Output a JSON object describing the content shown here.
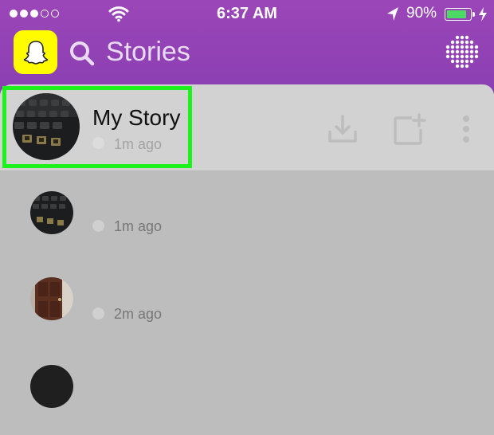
{
  "status_bar": {
    "time": "6:37 AM",
    "battery_percent": "90%",
    "battery_level": 0.9,
    "signal_bars_filled": 3,
    "signal_bars_total": 5,
    "icons": [
      "wifi-icon",
      "location-arrow-icon",
      "battery-icon",
      "charging-bolt-icon"
    ]
  },
  "header": {
    "title": "Stories",
    "icons": [
      "snapchat-ghost-icon",
      "search-icon",
      "discover-grid-icon"
    ]
  },
  "my_story": {
    "name": "My Story",
    "time": "1m ago",
    "actions": [
      "download-icon",
      "add-snap-icon",
      "more-vertical-icon"
    ],
    "highlight_color": "#1df21d"
  },
  "stories": [
    {
      "time": "1m ago"
    },
    {
      "time": "2m ago"
    }
  ],
  "colors": {
    "header_purple": "#9b46b8",
    "snapchat_yellow": "#fffc00"
  }
}
